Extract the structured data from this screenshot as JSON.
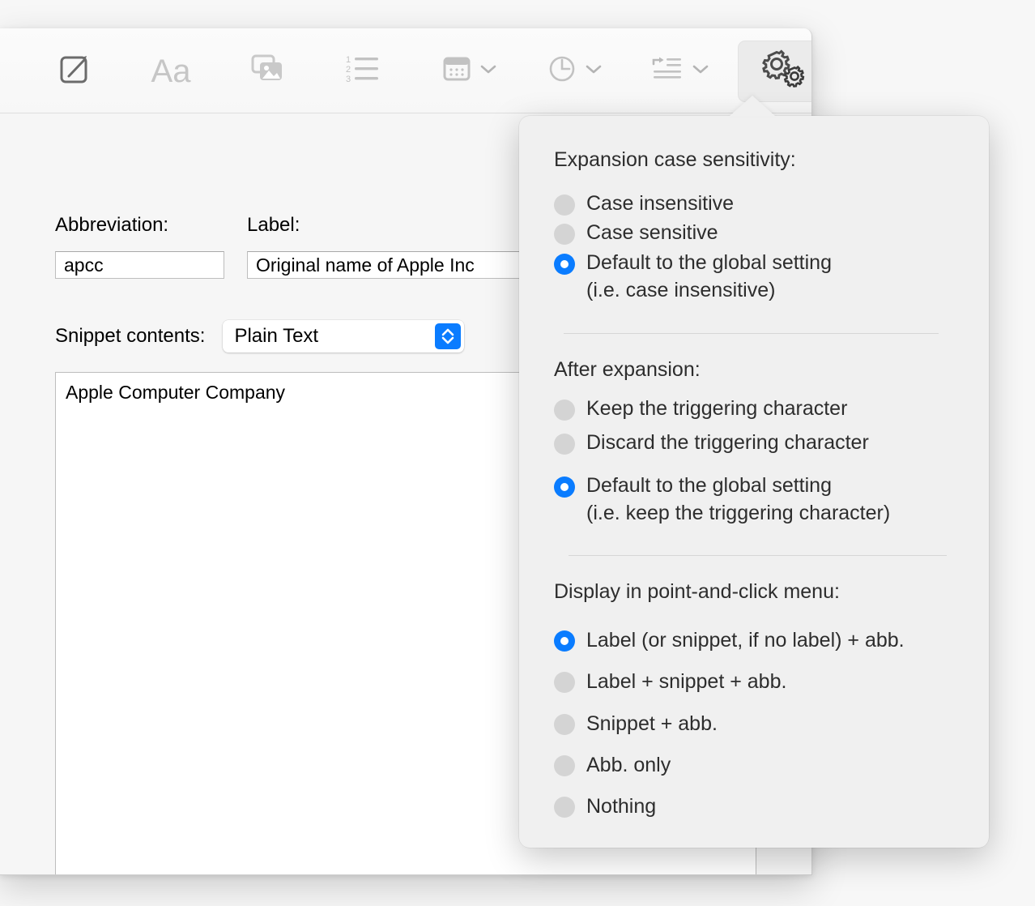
{
  "toolbar": {
    "items": [
      {
        "name": "new-snippet",
        "icon": "compose-icon",
        "has_menu": false
      },
      {
        "name": "font",
        "icon": "font-aa-icon",
        "has_menu": false,
        "label": "Aa"
      },
      {
        "name": "image",
        "icon": "image-icon",
        "has_menu": false
      },
      {
        "name": "numbered-list",
        "icon": "numbered-list-icon",
        "has_menu": false
      },
      {
        "name": "calendar",
        "icon": "calendar-icon",
        "has_menu": true
      },
      {
        "name": "clock",
        "icon": "clock-icon",
        "has_menu": true
      },
      {
        "name": "indent",
        "icon": "indent-icon",
        "has_menu": true
      },
      {
        "name": "settings",
        "icon": "gears-icon",
        "has_menu": false,
        "selected": true
      }
    ]
  },
  "form": {
    "abbreviation_label": "Abbreviation:",
    "abbreviation_value": "apcc",
    "abbreviation_placeholder": "",
    "label_label": "Label:",
    "label_value": "Original name of Apple Inc",
    "label_placeholder": "",
    "snippet_contents_label": "Snippet contents:",
    "snippet_format_selected": "Plain Text",
    "snippet_format_options": [
      "Plain Text"
    ],
    "snippet_body": "Apple Computer Company"
  },
  "popover": {
    "sections": [
      {
        "title": "Expansion case sensitivity:",
        "options": [
          {
            "label": "Case insensitive",
            "checked": false
          },
          {
            "label": "Case sensitive",
            "checked": false
          },
          {
            "label": "Default to the global setting\n(i.e. case insensitive)",
            "checked": true
          }
        ]
      },
      {
        "title": "After expansion:",
        "options": [
          {
            "label": "Keep the triggering character",
            "checked": false
          },
          {
            "label": "Discard the triggering character",
            "checked": false
          },
          {
            "label": "Default to the global setting\n(i.e. keep the triggering character)",
            "checked": true
          }
        ]
      },
      {
        "title": "Display in point-and-click menu:",
        "options": [
          {
            "label": "Label (or snippet, if no label) + abb.",
            "checked": true
          },
          {
            "label": "Label + snippet + abb.",
            "checked": false
          },
          {
            "label": "Snippet + abb.",
            "checked": false
          },
          {
            "label": "Abb. only",
            "checked": false
          },
          {
            "label": "Nothing",
            "checked": false
          }
        ]
      }
    ]
  },
  "colors": {
    "accent": "#0a7cff",
    "radio_off": "#d4d4d4",
    "popover_bg": "#f0f0f0",
    "window_bg": "#f6f6f6",
    "text": "#2d2d2d"
  }
}
